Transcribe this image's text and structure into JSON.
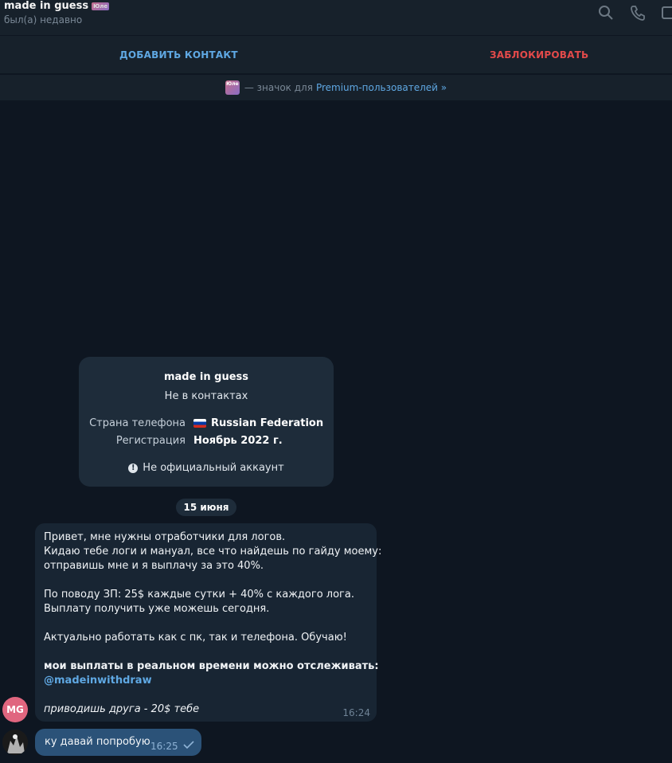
{
  "header": {
    "title": "made in guess",
    "title_badge": "Юле",
    "status": "был(а) недавно",
    "icons": [
      "search-icon",
      "phone-icon",
      "panel-icon"
    ]
  },
  "action_bar": {
    "add_contact": "ДОБАВИТЬ КОНТАКТ",
    "block": "ЗАБЛОКИРОВАТЬ"
  },
  "premium_bar": {
    "badge": "Юле",
    "text": "— значок для",
    "link": "Premium-пользователей »"
  },
  "info_card": {
    "name": "made in guess",
    "subtitle": "Не в контактах",
    "rows": [
      {
        "key": "Страна телефона",
        "value": "Russian Federation",
        "flag": "ru-flag-icon"
      },
      {
        "key": "Регистрация",
        "value": "Ноябрь 2022 г."
      }
    ],
    "note_icon": "!",
    "note": "Не официальный аккаунт"
  },
  "date_separator": "15 июня",
  "incoming": {
    "avatar_initials": "MG",
    "avatar_color": "#e0667f",
    "lines": [
      "Привет, мне нужны отработчики для логов.",
      "Кидаю тебе логи и мануал, все что найдешь по гайду моему:",
      "отправишь мне и я выплачу за это 40%.",
      "По поводу ЗП: 25$ каждые сутки + 40% с каждого лога.",
      "Выплату получить уже можешь сегодня.",
      "Актуально работать как с пк, так и телефона. Обучаю!",
      "мои выплаты в реальном времени можно отслеживать:",
      "@madeinwithdraw",
      "приводишь друга - 20$ тебе"
    ],
    "time": "16:24"
  },
  "outgoing": {
    "text": "ку давай попробую",
    "time": "16:25"
  },
  "colors": {
    "background": "#0e1621",
    "panel": "#17212b",
    "accent": "#5fa8e3",
    "danger": "#e34a4a",
    "bubble_in": "#182533",
    "bubble_out": "#2b5278"
  }
}
